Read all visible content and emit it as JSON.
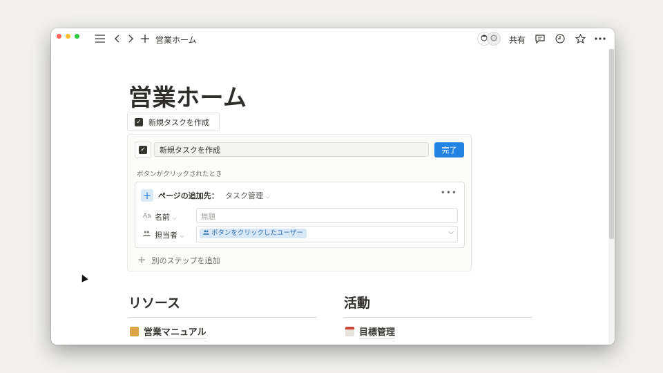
{
  "titlebar": {
    "breadcrumb": "営業ホーム",
    "share_label": "共有",
    "icons": [
      "menu-icon",
      "back-icon",
      "forward-icon",
      "plus-icon",
      "comment-icon",
      "clock-icon",
      "star-icon",
      "more-icon"
    ]
  },
  "page": {
    "title": "営業ホーム",
    "button_label": "新規タスクを作成"
  },
  "editor": {
    "name_value": "新規タスクを作成",
    "done_label": "完了",
    "trigger_label": "ボタンがクリックされたとき",
    "action": {
      "label": "ページの追加先：",
      "database": "タスク管理",
      "properties": [
        {
          "icon": "Aa",
          "label": "名前",
          "placeholder": "無題"
        },
        {
          "icon": "👥",
          "label": "担当者",
          "tag": "ボタンをクリックしたユーザー"
        }
      ]
    },
    "add_step_label": "別のステップを追加"
  },
  "columns": {
    "left": {
      "heading": "リソース",
      "link": "営業マニュアル"
    },
    "right": {
      "heading": "活動",
      "link": "目標管理"
    }
  },
  "colors": {
    "accent": "#2383e2",
    "text": "#37352f"
  }
}
